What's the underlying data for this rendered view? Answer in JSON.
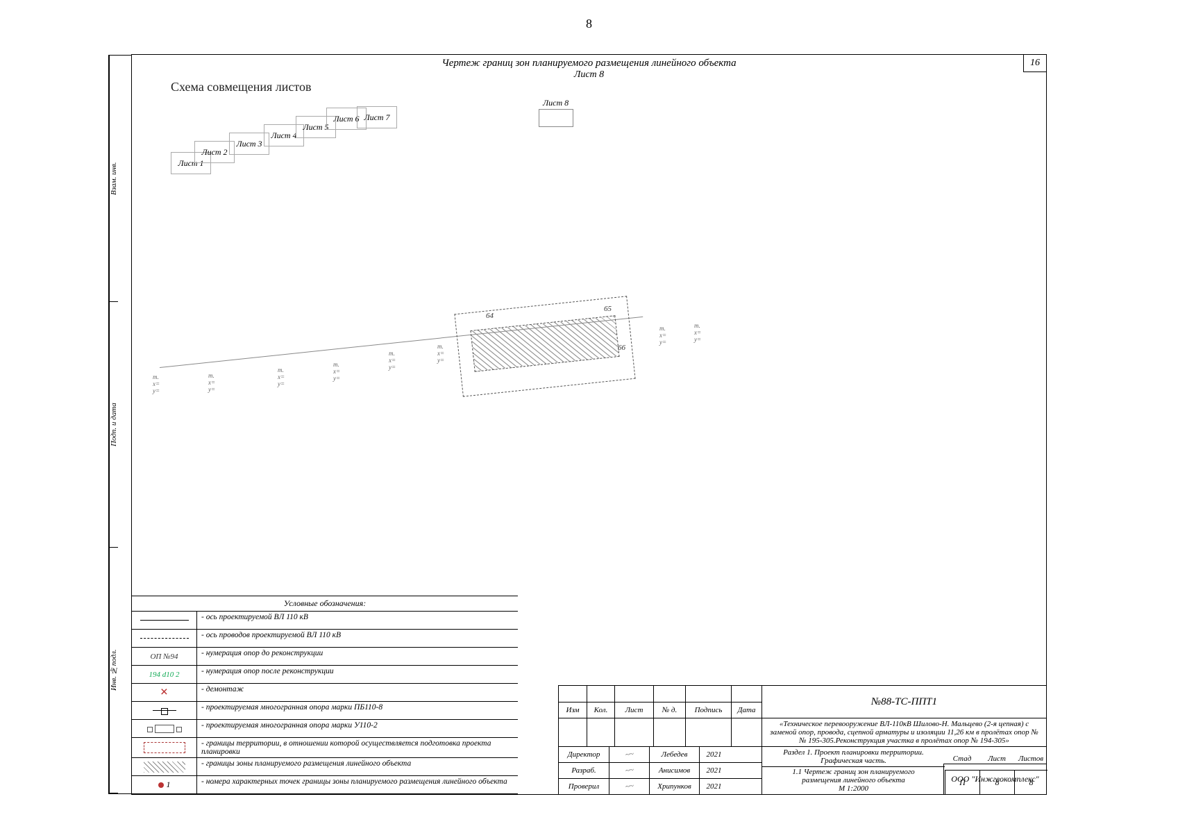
{
  "page_number": "8",
  "header": {
    "title": "Чертеж границ зон планируемого размещения линейного объекта",
    "sheet": "Лист 8",
    "top_right_number": "16"
  },
  "binding_labels": [
    "Взам. инв.",
    "Подп. и дата",
    "Инв. №подл."
  ],
  "layout_diagram": {
    "title": "Схема совмещения листов",
    "sheets": [
      "Лист 1",
      "Лист 2",
      "Лист 3",
      "Лист 4",
      "Лист 5",
      "Лист 6",
      "Лист 7"
    ],
    "current_sheet_marker": "Лист 8"
  },
  "plan": {
    "tower_old_labels": [
      "64",
      "65",
      "66"
    ],
    "tower_new_label_example": "ОП №94",
    "axis_note": "ось проводов",
    "survey_point_groups": [
      {
        "x": "_",
        "y": "_"
      }
    ]
  },
  "legend": {
    "title": "Условные обозначения:",
    "rows": [
      {
        "sym": "line-solid",
        "text": "- ось проектируемой ВЛ 110 кВ"
      },
      {
        "sym": "line-dashdot",
        "text": "- ось проводов проектируемой ВЛ 110 кВ"
      },
      {
        "sym": "text",
        "sym_text": "ОП  №94",
        "text": "- нумерация опор до реконструкции"
      },
      {
        "sym": "text-green",
        "sym_text": "194  d10 2",
        "text": "- нумерация опор после реконструкции"
      },
      {
        "sym": "x",
        "text": "- демонтаж"
      },
      {
        "sym": "tower",
        "text": "- проектируемая многогранная опора марки ПБ110-8"
      },
      {
        "sym": "plan",
        "text": "- проектируемая многогранная опора марки У110-2"
      },
      {
        "sym": "dashed-box",
        "text": "- границы территории, в отношении которой осуществляется подготовка проекта планировки"
      },
      {
        "sym": "hatch",
        "text": "- границы зоны планируемого размещения линейного объекта"
      },
      {
        "sym": "point",
        "sym_text": "1",
        "text": "- номера характерных точек границы зоны планируемого размещения линейного объекта"
      }
    ]
  },
  "titleblock": {
    "doc_code": "№88-ТС-ППТ1",
    "project_desc": "«Техническое перевооружение ВЛ-110кВ Шилово-Н. Мальцево (2-я цепная) с заменой опор, провода, сцепной арматуры и изоляции 11,26 км в пролётах опор №№ 195-305.Реконструкция участка в пролётах опор № 194-305»",
    "section_title": "Раздел 1. Проект планировки территории.",
    "graphic_part": "Графическая часть.",
    "drawing_title_1": "1.1 Чертеж границ зон планируемого",
    "drawing_title_2": "размещения линейного объекта",
    "scale": "М 1:2000",
    "company": "ООО \"Инжгеокомплекс\"",
    "cols": {
      "stage": "Стад",
      "sheet": "Лист",
      "sheets": "Листов"
    },
    "vals": {
      "stage": "П",
      "sheet": "8",
      "sheets": "8"
    },
    "rev_head": {
      "izm": "Изм",
      "kol": "Кол.",
      "list": "Лист",
      "doc": "№ д.",
      "podp": "Подпись",
      "date": "Дата"
    },
    "signers": [
      {
        "role": "Директор",
        "name": "Лебедев",
        "year": "2021"
      },
      {
        "role": "Разраб.",
        "name": "Анисимов",
        "year": "2021"
      },
      {
        "role": "Проверил",
        "name": "Хрипунков",
        "year": "2021"
      }
    ]
  }
}
